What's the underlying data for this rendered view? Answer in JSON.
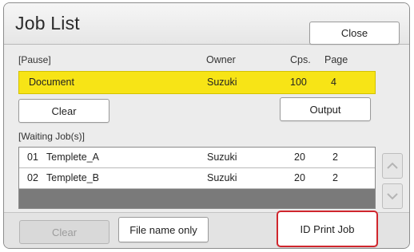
{
  "window": {
    "title": "Job List",
    "close_label": "Close"
  },
  "pause": {
    "section_label": "[Pause]",
    "columns": {
      "owner": "Owner",
      "copies": "Cps.",
      "page": "Page"
    },
    "row": {
      "name": "Document",
      "owner": "Suzuki",
      "copies": "100",
      "page": "4"
    },
    "clear_label": "Clear",
    "output_label": "Output"
  },
  "waiting": {
    "section_label": "[Waiting Job(s)]",
    "rows": [
      {
        "num": "01",
        "name": "Templete_A",
        "owner": "Suzuki",
        "copies": "20",
        "page": "2"
      },
      {
        "num": "02",
        "name": "Templete_B",
        "owner": "Suzuki",
        "copies": "20",
        "page": "2"
      }
    ]
  },
  "footer": {
    "clear_label": "Clear",
    "file_name_only_label": "File name only",
    "id_print_job_label": "ID Print Job"
  },
  "colors": {
    "highlight_row": "#f7e416",
    "focus_outline": "#d0262d"
  },
  "icons": {
    "scroll_up": "chevron-up-icon",
    "scroll_down": "chevron-down-icon"
  }
}
